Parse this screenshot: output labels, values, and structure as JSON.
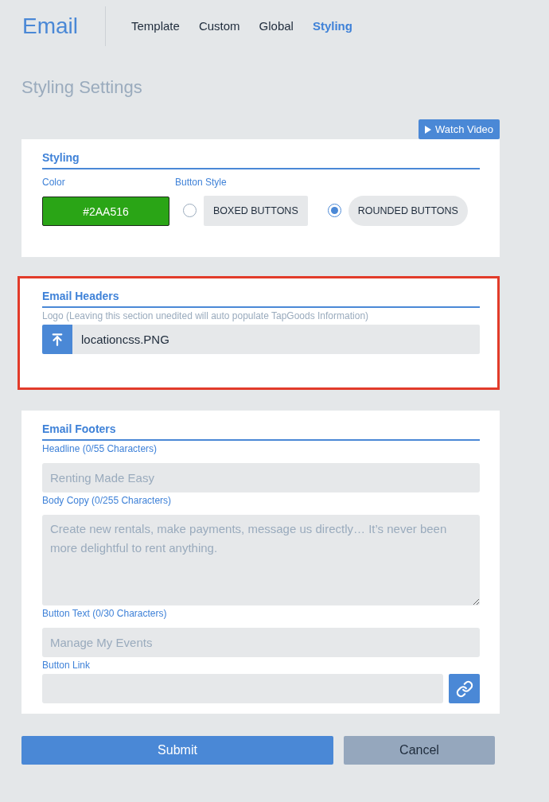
{
  "header": {
    "title": "Email",
    "tabs": [
      {
        "label": "Template",
        "selected": false
      },
      {
        "label": "Custom",
        "selected": false
      },
      {
        "label": "Global",
        "selected": false
      },
      {
        "label": "Styling",
        "selected": true
      }
    ]
  },
  "page_title": "Styling Settings",
  "watch_video_button": {
    "label": "Watch Video"
  },
  "styling": {
    "title": "Styling",
    "color_field": {
      "label": "Color",
      "value": "#2AA516"
    },
    "button_style": {
      "label": "Button Style",
      "options": [
        {
          "label": "BOXED BUTTONS",
          "kind": "boxed",
          "selected": false
        },
        {
          "label": "ROUNDED BUTTONS",
          "kind": "rounded",
          "selected": true
        }
      ]
    }
  },
  "email_headers": {
    "title": "Email Headers",
    "highlighted": true,
    "logo_label": "Logo (Leaving this section unedited will auto populate TapGoods Information)",
    "logo_file": "locationcss.PNG"
  },
  "email_footers": {
    "title": "Email Footers",
    "fields": [
      {
        "kind": "input",
        "label": "Headline (0/55 Characters)",
        "placeholder": "Renting Made Easy"
      },
      {
        "kind": "textarea",
        "label": "Body Copy (0/255 Characters)",
        "placeholder": "Create new rentals, make payments, message us directly… It’s never been more delightful to rent anything."
      },
      {
        "kind": "input",
        "label": "Button Text (0/30 Characters)",
        "placeholder": "Manage My Events"
      },
      {
        "kind": "link",
        "label": "Button Link"
      }
    ]
  },
  "actions": [
    {
      "label": "Submit",
      "kind": "primary"
    },
    {
      "label": "Cancel",
      "kind": "secondary"
    }
  ]
}
